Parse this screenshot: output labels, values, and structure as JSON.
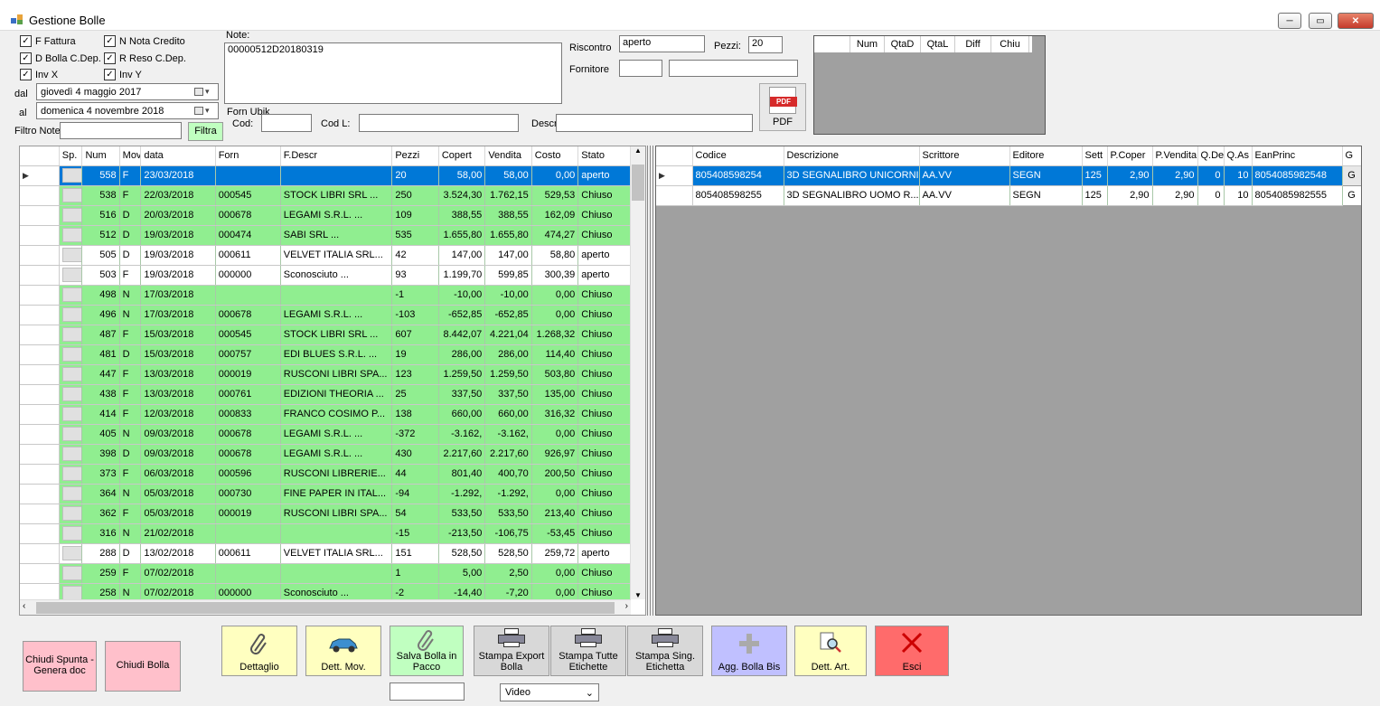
{
  "window": {
    "title": "Gestione Bolle",
    "min": "─",
    "max": "▭",
    "close": "✕"
  },
  "filters": {
    "checks": [
      {
        "label": "F Fattura",
        "checked": true
      },
      {
        "label": "N Nota Credito",
        "checked": true
      },
      {
        "label": "D Bolla C.Dep.",
        "checked": true
      },
      {
        "label": "R Reso C.Dep.",
        "checked": true
      },
      {
        "label": "Inv X",
        "checked": true
      },
      {
        "label": "Inv Y",
        "checked": true
      }
    ],
    "dal_label": "dal",
    "al_label": "al",
    "dal_value": "giovedì    4   maggio   2017",
    "al_value": "domenica   4 novembre 2018",
    "filtro_note_label": "Filtro Note",
    "filtro_note_value": "",
    "filtra_label": "Filtra"
  },
  "note": {
    "label": "Note:",
    "value": "00000512D20180319"
  },
  "riscontro": {
    "label": "Riscontro",
    "value": "aperto",
    "pezzi_label": "Pezzi:",
    "pezzi_value": "20",
    "fornitore_label": "Fornitore",
    "fornitore_code": "",
    "fornitore_name": ""
  },
  "forn_ubik": {
    "group_label": "Forn Ubik",
    "cod_label": "Cod:",
    "cod_value": "",
    "codl_label": "Cod L:",
    "codl_value": "",
    "descr_label": "Descr:",
    "descr_value": ""
  },
  "pdf_label": "PDF",
  "pdf_icon_text": "PDF",
  "top_grid_headers": [
    "Num",
    "QtaD",
    "QtaL",
    "Diff",
    "Chiu"
  ],
  "left_grid": {
    "headers": [
      "Sp.",
      "Num",
      "Mov",
      "data",
      "Forn",
      "F.Descr",
      "Pezzi",
      "Copert",
      "Vendita",
      "Costo",
      "Stato"
    ],
    "rows": [
      {
        "style": "sel",
        "num": "558",
        "mov": "F",
        "data": "23/03/2018",
        "forn": "",
        "descr": "",
        "pezzi": "20",
        "copert": "58,00",
        "vendita": "58,00",
        "costo": "0,00",
        "stato": "aperto"
      },
      {
        "style": "green",
        "num": "538",
        "mov": "F",
        "data": "22/03/2018",
        "forn": "000545",
        "descr": "STOCK LIBRI SRL        ...",
        "pezzi": "250",
        "copert": "3.524,30",
        "vendita": "1.762,15",
        "costo": "529,53",
        "stato": "Chiuso"
      },
      {
        "style": "green",
        "num": "516",
        "mov": "D",
        "data": "20/03/2018",
        "forn": "000678",
        "descr": "LEGAMI S.R.L.           ...",
        "pezzi": "109",
        "copert": "388,55",
        "vendita": "388,55",
        "costo": "162,09",
        "stato": "Chiuso"
      },
      {
        "style": "green",
        "num": "512",
        "mov": "D",
        "data": "19/03/2018",
        "forn": "000474",
        "descr": "SABI SRL                  ...",
        "pezzi": "535",
        "copert": "1.655,80",
        "vendita": "1.655,80",
        "costo": "474,27",
        "stato": "Chiuso"
      },
      {
        "style": "white",
        "num": "505",
        "mov": "D",
        "data": "19/03/2018",
        "forn": "000611",
        "descr": "VELVET ITALIA SRL...",
        "pezzi": "42",
        "copert": "147,00",
        "vendita": "147,00",
        "costo": "58,80",
        "stato": "aperto"
      },
      {
        "style": "white",
        "num": "503",
        "mov": "F",
        "data": "19/03/2018",
        "forn": "000000",
        "descr": "Sconosciuto              ...",
        "pezzi": "93",
        "copert": "1.199,70",
        "vendita": "599,85",
        "costo": "300,39",
        "stato": "aperto"
      },
      {
        "style": "green",
        "num": "498",
        "mov": "N",
        "data": "17/03/2018",
        "forn": "",
        "descr": "",
        "pezzi": "-1",
        "copert": "-10,00",
        "vendita": "-10,00",
        "costo": "0,00",
        "stato": "Chiuso"
      },
      {
        "style": "green",
        "num": "496",
        "mov": "N",
        "data": "17/03/2018",
        "forn": "000678",
        "descr": "LEGAMI S.R.L.           ...",
        "pezzi": "-103",
        "copert": "-652,85",
        "vendita": "-652,85",
        "costo": "0,00",
        "stato": "Chiuso"
      },
      {
        "style": "green",
        "num": "487",
        "mov": "F",
        "data": "15/03/2018",
        "forn": "000545",
        "descr": "STOCK LIBRI SRL        ...",
        "pezzi": "607",
        "copert": "8.442,07",
        "vendita": "4.221,04",
        "costo": "1.268,32",
        "stato": "Chiuso"
      },
      {
        "style": "green",
        "num": "481",
        "mov": "D",
        "data": "15/03/2018",
        "forn": "000757",
        "descr": "EDI BLUES S.R.L.        ...",
        "pezzi": "19",
        "copert": "286,00",
        "vendita": "286,00",
        "costo": "114,40",
        "stato": "Chiuso"
      },
      {
        "style": "green",
        "num": "447",
        "mov": "F",
        "data": "13/03/2018",
        "forn": "000019",
        "descr": "RUSCONI LIBRI SPA...",
        "pezzi": "123",
        "copert": "1.259,50",
        "vendita": "1.259,50",
        "costo": "503,80",
        "stato": "Chiuso"
      },
      {
        "style": "green",
        "num": "438",
        "mov": "F",
        "data": "13/03/2018",
        "forn": "000761",
        "descr": "EDIZIONI THEORIA ...",
        "pezzi": "25",
        "copert": "337,50",
        "vendita": "337,50",
        "costo": "135,00",
        "stato": "Chiuso"
      },
      {
        "style": "green",
        "num": "414",
        "mov": "F",
        "data": "12/03/2018",
        "forn": "000833",
        "descr": "FRANCO COSIMO P...",
        "pezzi": "138",
        "copert": "660,00",
        "vendita": "660,00",
        "costo": "316,32",
        "stato": "Chiuso"
      },
      {
        "style": "green",
        "num": "405",
        "mov": "N",
        "data": "09/03/2018",
        "forn": "000678",
        "descr": "LEGAMI S.R.L.           ...",
        "pezzi": "-372",
        "copert": "-3.162,",
        "vendita": "-3.162,",
        "costo": "0,00",
        "stato": "Chiuso"
      },
      {
        "style": "green",
        "num": "398",
        "mov": "D",
        "data": "09/03/2018",
        "forn": "000678",
        "descr": "LEGAMI S.R.L.           ...",
        "pezzi": "430",
        "copert": "2.217,60",
        "vendita": "2.217,60",
        "costo": "926,97",
        "stato": "Chiuso"
      },
      {
        "style": "green",
        "num": "373",
        "mov": "F",
        "data": "06/03/2018",
        "forn": "000596",
        "descr": "RUSCONI LIBRERIE...",
        "pezzi": "44",
        "copert": "801,40",
        "vendita": "400,70",
        "costo": "200,50",
        "stato": "Chiuso"
      },
      {
        "style": "green",
        "num": "364",
        "mov": "N",
        "data": "05/03/2018",
        "forn": "000730",
        "descr": "FINE PAPER IN ITAL...",
        "pezzi": "-94",
        "copert": "-1.292,",
        "vendita": "-1.292,",
        "costo": "0,00",
        "stato": "Chiuso"
      },
      {
        "style": "green",
        "num": "362",
        "mov": "F",
        "data": "05/03/2018",
        "forn": "000019",
        "descr": "RUSCONI LIBRI SPA...",
        "pezzi": "54",
        "copert": "533,50",
        "vendita": "533,50",
        "costo": "213,40",
        "stato": "Chiuso"
      },
      {
        "style": "green",
        "num": "316",
        "mov": "N",
        "data": "21/02/2018",
        "forn": "",
        "descr": "",
        "pezzi": "-15",
        "copert": "-213,50",
        "vendita": "-106,75",
        "costo": "-53,45",
        "stato": "Chiuso"
      },
      {
        "style": "white",
        "num": "288",
        "mov": "D",
        "data": "13/02/2018",
        "forn": "000611",
        "descr": "VELVET ITALIA SRL...",
        "pezzi": "151",
        "copert": "528,50",
        "vendita": "528,50",
        "costo": "259,72",
        "stato": "aperto"
      },
      {
        "style": "green",
        "num": "259",
        "mov": "F",
        "data": "07/02/2018",
        "forn": "",
        "descr": "",
        "pezzi": "1",
        "copert": "5,00",
        "vendita": "2,50",
        "costo": "0,00",
        "stato": "Chiuso"
      },
      {
        "style": "green",
        "num": "258",
        "mov": "N",
        "data": "07/02/2018",
        "forn": "000000",
        "descr": "Sconosciuto              ...",
        "pezzi": "-2",
        "copert": "-14,40",
        "vendita": "-7,20",
        "costo": "0,00",
        "stato": "Chiuso"
      }
    ]
  },
  "right_grid": {
    "headers": [
      "Codice",
      "Descrizione",
      "Scrittore",
      "Editore",
      "Sett",
      "P.Coper",
      "P.Vendita",
      "Q.De",
      "Q.As",
      "EanPrinc",
      "G"
    ],
    "rows": [
      {
        "style": "sel",
        "codice": "805408598254",
        "descr": "3D SEGNALIBRO UNICORNI",
        "scrittore": "AA.VV",
        "editore": "SEGN",
        "sett": "125",
        "pcoper": "2,90",
        "pvend": "2,90",
        "qde": "0",
        "qas": "10",
        "ean": "8054085982548",
        "g": "G"
      },
      {
        "style": "white",
        "codice": "805408598255",
        "descr": "3D SEGNALIBRO UOMO R...",
        "scrittore": "AA.VV",
        "editore": "SEGN",
        "sett": "125",
        "pcoper": "2,90",
        "pvend": "2,90",
        "qde": "0",
        "qas": "10",
        "ean": "8054085982555",
        "g": "G"
      }
    ]
  },
  "buttons": {
    "chiudi_spunta": "Chiudi Spunta - Genera doc",
    "chiudi_bolla": "Chiudi Bolla",
    "dettaglio": "Dettaglio",
    "dett_mov": "Dett. Mov.",
    "salva_bolla": "Salva Bolla in Pacco",
    "stampa_export": "Stampa Export Bolla",
    "stampa_tutte": "Stampa Tutte Etichette",
    "stampa_sing": "Stampa Sing. Etichetta",
    "agg_bolla": "Agg. Bolla Bis",
    "dett_art": "Dett. Art.",
    "esci": "Esci"
  },
  "bottom": {
    "pacco_value": "",
    "video_value": "Video"
  }
}
